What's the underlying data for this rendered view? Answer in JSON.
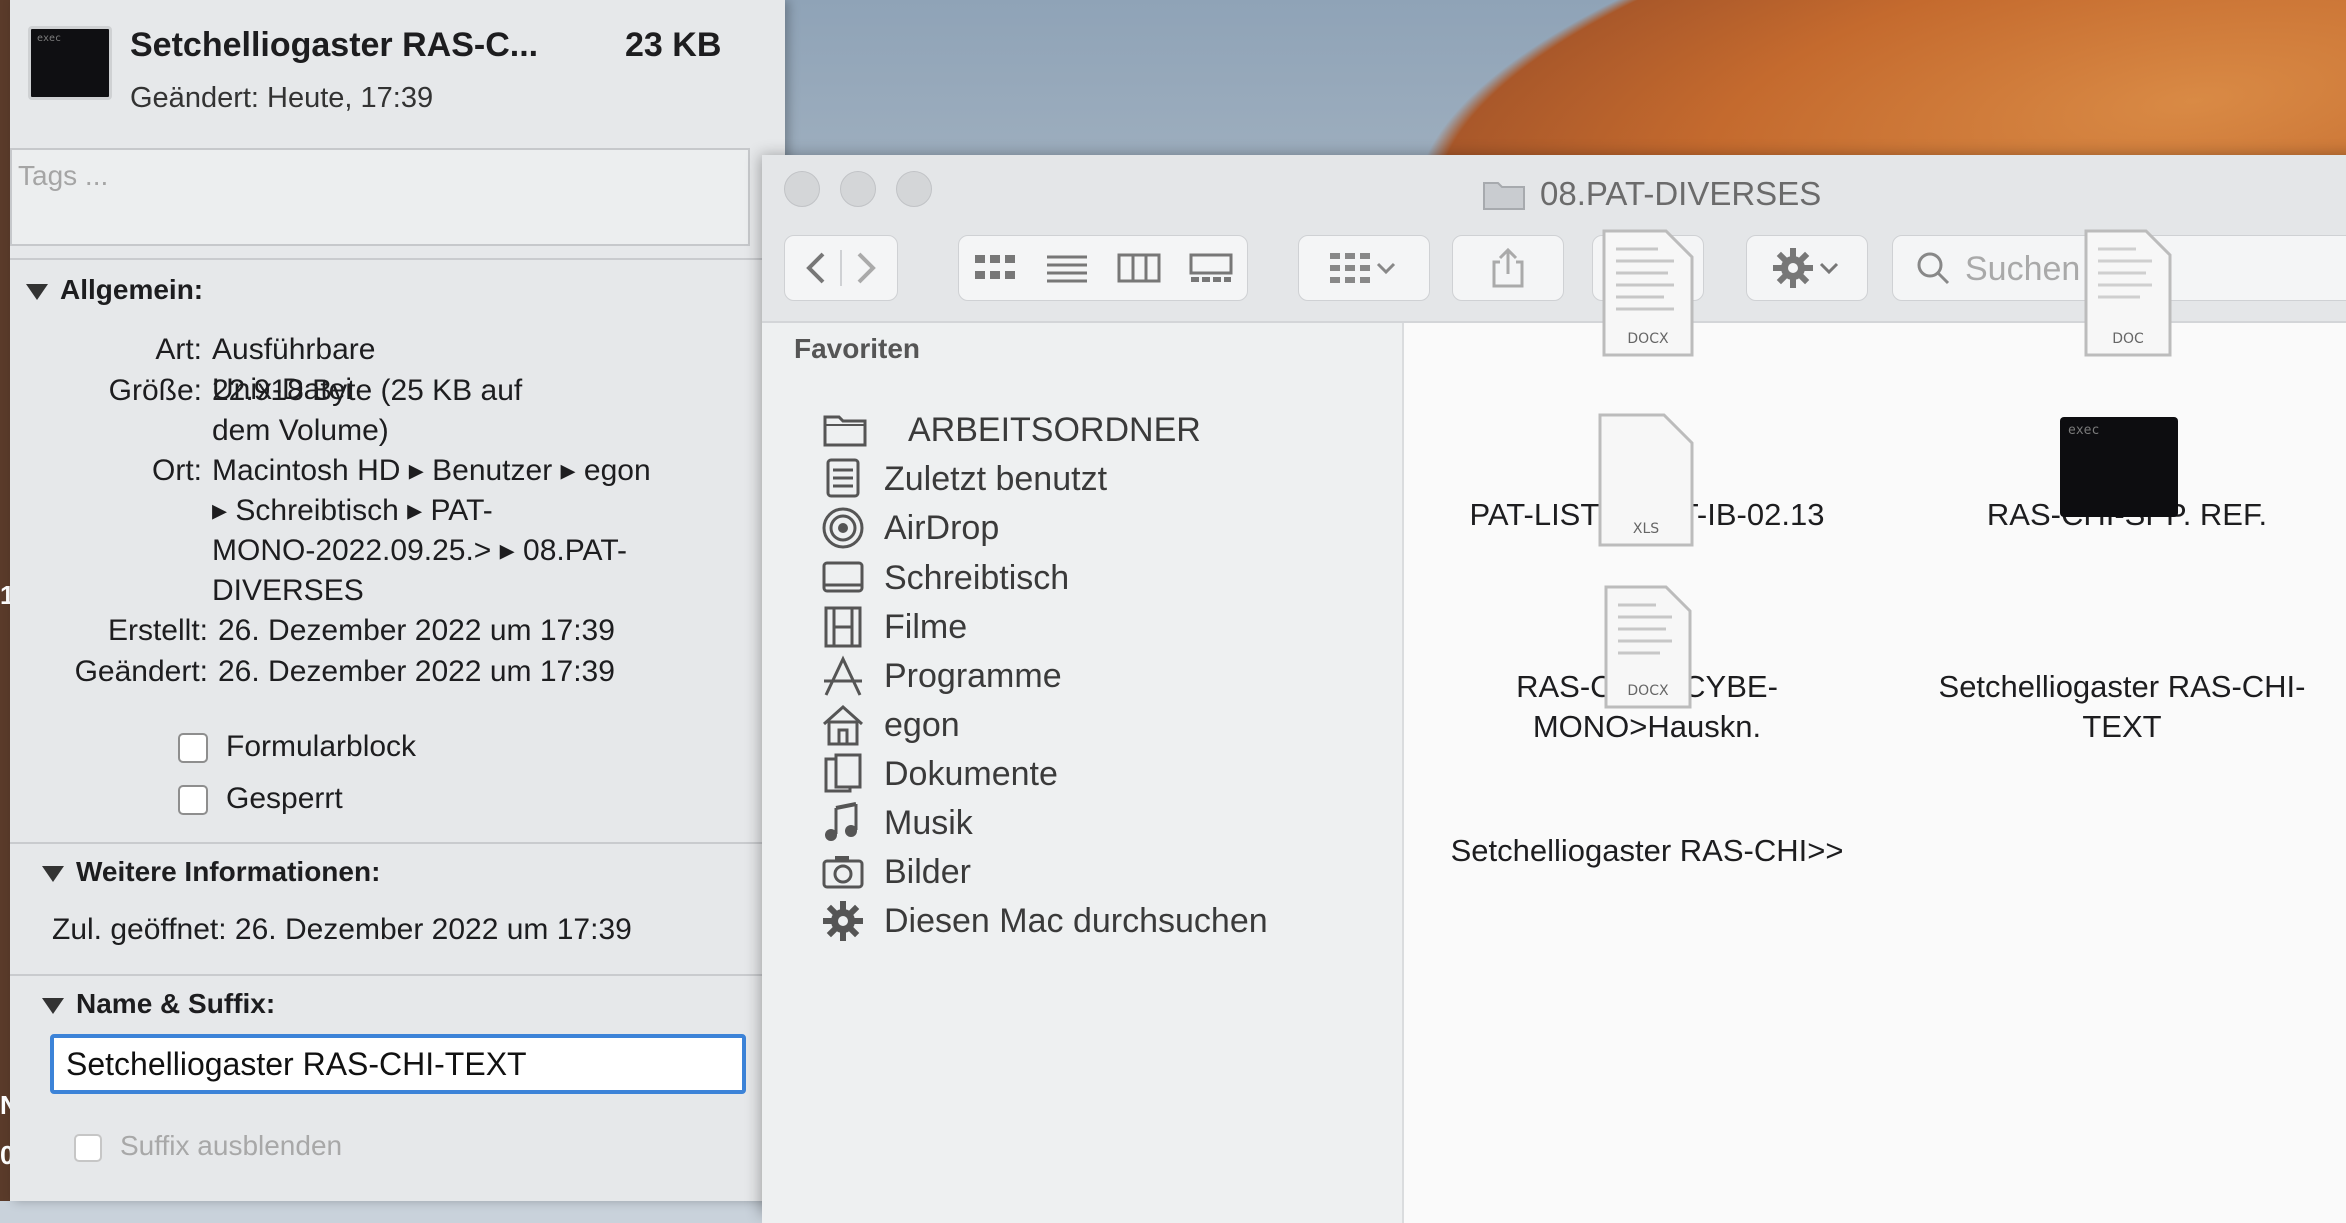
{
  "info_panel": {
    "file_name": "Setchelliogaster RAS-C...",
    "file_size": "23 KB",
    "modified_short": "Geändert: Heute, 17:39",
    "thumb_label": "exec",
    "tags_placeholder": "Tags ...",
    "general": {
      "header": "Allgemein:",
      "type_label": "Art:",
      "type_value": "Ausführbare Unix-Datei",
      "size_label": "Größe:",
      "size_value_line1": "22.918 Byte (25 KB auf",
      "size_value_line2": "dem Volume)",
      "location_label": "Ort:",
      "location_line1": "Macintosh HD ▸ Benutzer ▸ egon",
      "location_line2": "▸ Schreibtisch ▸ PAT-",
      "location_line3": "MONO-2022.09.25.> ▸ 08.PAT-",
      "location_line4": "DIVERSES",
      "created_label": "Erstellt:",
      "created_value": "26. Dezember 2022 um 17:39",
      "modified_label": "Geändert:",
      "modified_value": "26. Dezember 2022 um 17:39",
      "checkbox_stationery": "Formularblock",
      "checkbox_locked": "Gesperrt"
    },
    "more_info": {
      "header": "Weitere Informationen:",
      "last_opened": "Zul. geöffnet: 26. Dezember 2022 um 17:39"
    },
    "name_suffix": {
      "header": "Name & Suffix:",
      "name_value": "Setchelliogaster RAS-CHI-TEXT",
      "hide_extension": "Suffix ausblenden"
    }
  },
  "finder": {
    "window_title": "08.PAT-DIVERSES",
    "search_placeholder": "Suchen",
    "sidebar": {
      "header": "Favoriten",
      "items": [
        {
          "label": "ARBEITSORDNER",
          "icon": "folder-icon"
        },
        {
          "label": "Zuletzt benutzt",
          "icon": "recents-icon"
        },
        {
          "label": "AirDrop",
          "icon": "airdrop-icon"
        },
        {
          "label": "Schreibtisch",
          "icon": "desktop-icon"
        },
        {
          "label": "Filme",
          "icon": "movies-icon"
        },
        {
          "label": "Programme",
          "icon": "applications-icon"
        },
        {
          "label": "egon",
          "icon": "home-icon"
        },
        {
          "label": "Dokumente",
          "icon": "documents-icon"
        },
        {
          "label": "Musik",
          "icon": "music-icon"
        },
        {
          "label": "Bilder",
          "icon": "camera-icon"
        },
        {
          "label": "Diesen Mac durchsuchen",
          "icon": "gear-icon"
        }
      ]
    },
    "files": [
      {
        "name": "PAT-LIST ?? -ZT-IB-02.13",
        "ext": "DOCX"
      },
      {
        "name": "RAS-CHI-SPP. REF.",
        "ext": "DOC"
      },
      {
        "name_line1": "RAS-CONOCYBE-",
        "name_line2": "MONO>Hauskn.",
        "ext": "XLS"
      },
      {
        "name_line1": "Setchelliogaster RAS-CHI-",
        "name_line2": "TEXT",
        "ext": "exec"
      },
      {
        "name": "Setchelliogaster RAS-CHI>>",
        "ext": "DOCX"
      }
    ]
  },
  "left_edge": {
    "char1": "N",
    "char2": "0",
    "char3": "1"
  }
}
